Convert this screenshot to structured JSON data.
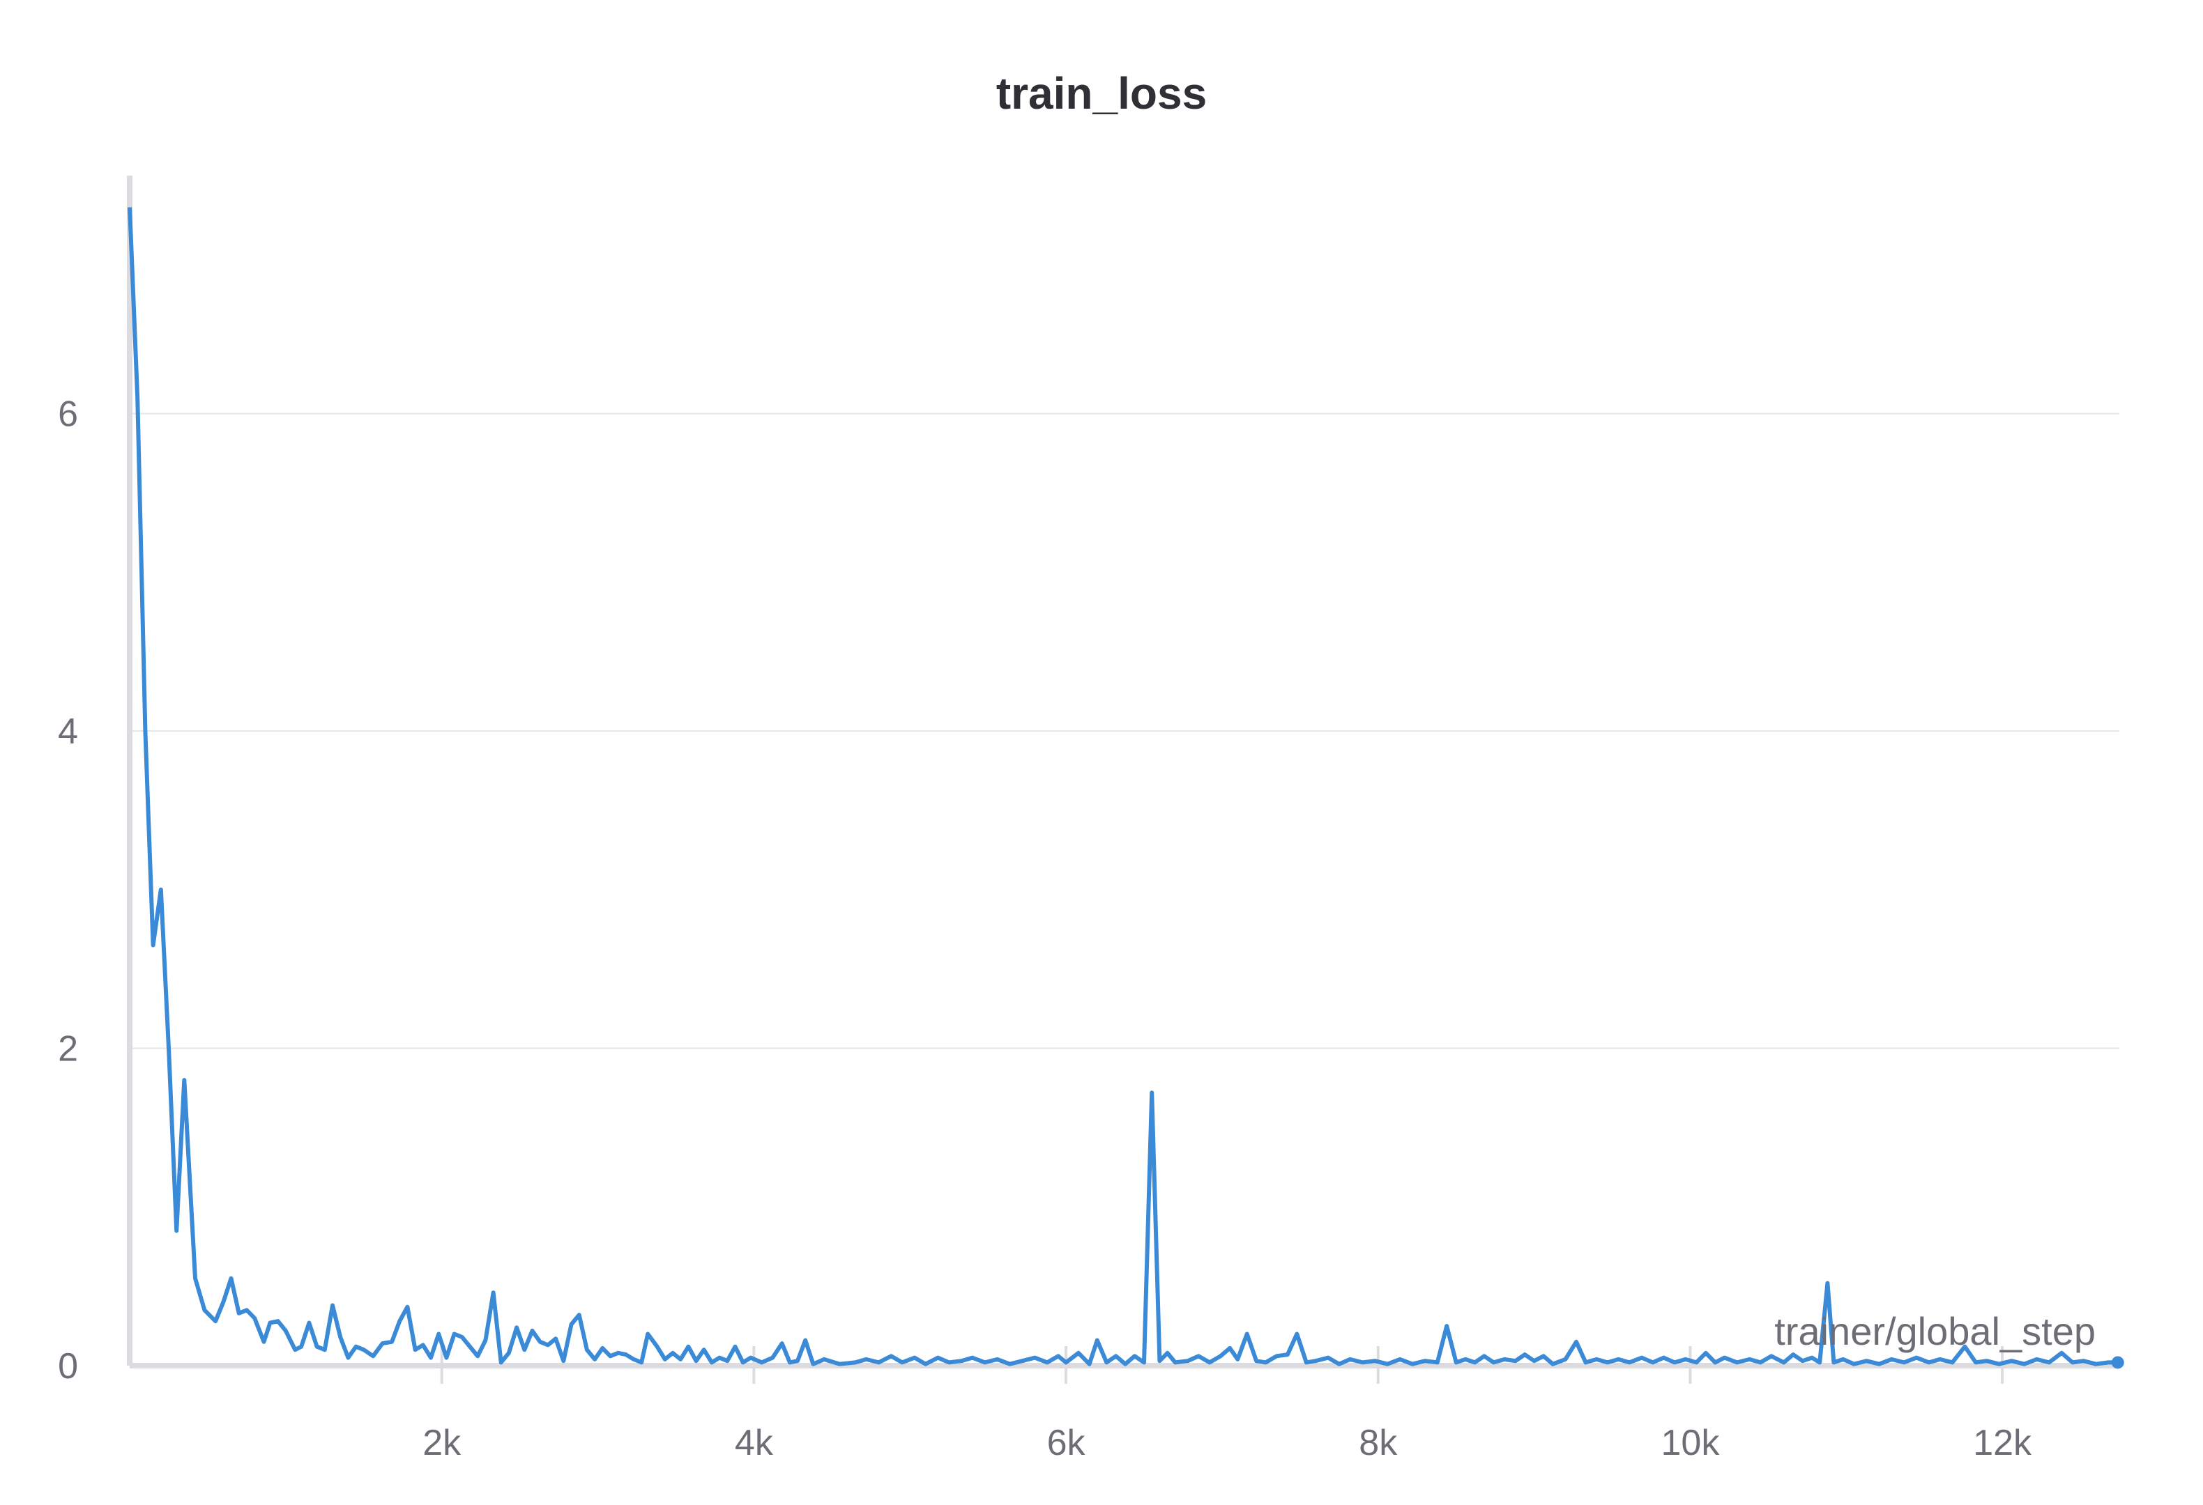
{
  "chart_data": {
    "type": "line",
    "title": "train_loss",
    "xlabel": "trainer/global_step",
    "ylabel": "",
    "xlim": [
      0,
      12750
    ],
    "ylim": [
      0,
      7.5
    ],
    "grid": true,
    "line_color": "#3a8ad8",
    "x_ticks": [
      {
        "value": 2000,
        "label": "2k"
      },
      {
        "value": 4000,
        "label": "4k"
      },
      {
        "value": 6000,
        "label": "6k"
      },
      {
        "value": 8000,
        "label": "8k"
      },
      {
        "value": 10000,
        "label": "10k"
      },
      {
        "value": 12000,
        "label": "12k"
      }
    ],
    "y_ticks": [
      {
        "value": 0,
        "label": "0"
      },
      {
        "value": 2,
        "label": "2"
      },
      {
        "value": 4,
        "label": "4"
      },
      {
        "value": 6,
        "label": "6"
      }
    ],
    "series": [
      {
        "values": [
          [
            0,
            7.3
          ],
          [
            50,
            6.1
          ],
          [
            100,
            4.0
          ],
          [
            150,
            2.65
          ],
          [
            200,
            3.0
          ],
          [
            250,
            2.0
          ],
          [
            300,
            0.85
          ],
          [
            350,
            1.8
          ],
          [
            420,
            0.55
          ],
          [
            480,
            0.35
          ],
          [
            550,
            0.28
          ],
          [
            600,
            0.4
          ],
          [
            650,
            0.55
          ],
          [
            700,
            0.33
          ],
          [
            750,
            0.35
          ],
          [
            800,
            0.3
          ],
          [
            860,
            0.15
          ],
          [
            900,
            0.27
          ],
          [
            950,
            0.28
          ],
          [
            1000,
            0.22
          ],
          [
            1060,
            0.1
          ],
          [
            1100,
            0.12
          ],
          [
            1150,
            0.27
          ],
          [
            1200,
            0.12
          ],
          [
            1250,
            0.1
          ],
          [
            1300,
            0.38
          ],
          [
            1350,
            0.18
          ],
          [
            1400,
            0.05
          ],
          [
            1450,
            0.12
          ],
          [
            1500,
            0.1
          ],
          [
            1560,
            0.06
          ],
          [
            1620,
            0.14
          ],
          [
            1680,
            0.15
          ],
          [
            1730,
            0.28
          ],
          [
            1780,
            0.37
          ],
          [
            1830,
            0.1
          ],
          [
            1880,
            0.13
          ],
          [
            1930,
            0.05
          ],
          [
            1980,
            0.2
          ],
          [
            2030,
            0.05
          ],
          [
            2080,
            0.2
          ],
          [
            2130,
            0.18
          ],
          [
            2180,
            0.12
          ],
          [
            2230,
            0.06
          ],
          [
            2280,
            0.16
          ],
          [
            2330,
            0.46
          ],
          [
            2380,
            0.02
          ],
          [
            2430,
            0.08
          ],
          [
            2480,
            0.24
          ],
          [
            2530,
            0.1
          ],
          [
            2580,
            0.22
          ],
          [
            2630,
            0.15
          ],
          [
            2680,
            0.13
          ],
          [
            2730,
            0.17
          ],
          [
            2780,
            0.03
          ],
          [
            2830,
            0.26
          ],
          [
            2880,
            0.32
          ],
          [
            2930,
            0.1
          ],
          [
            2980,
            0.04
          ],
          [
            3030,
            0.11
          ],
          [
            3080,
            0.06
          ],
          [
            3130,
            0.08
          ],
          [
            3180,
            0.07
          ],
          [
            3230,
            0.04
          ],
          [
            3280,
            0.02
          ],
          [
            3320,
            0.2
          ],
          [
            3380,
            0.12
          ],
          [
            3430,
            0.04
          ],
          [
            3480,
            0.08
          ],
          [
            3530,
            0.04
          ],
          [
            3580,
            0.12
          ],
          [
            3630,
            0.03
          ],
          [
            3680,
            0.1
          ],
          [
            3730,
            0.02
          ],
          [
            3780,
            0.05
          ],
          [
            3830,
            0.03
          ],
          [
            3880,
            0.12
          ],
          [
            3930,
            0.02
          ],
          [
            3980,
            0.05
          ],
          [
            4050,
            0.02
          ],
          [
            4120,
            0.05
          ],
          [
            4180,
            0.14
          ],
          [
            4230,
            0.02
          ],
          [
            4280,
            0.03
          ],
          [
            4330,
            0.16
          ],
          [
            4380,
            0.01
          ],
          [
            4450,
            0.04
          ],
          [
            4550,
            0.01
          ],
          [
            4650,
            0.02
          ],
          [
            4720,
            0.04
          ],
          [
            4800,
            0.02
          ],
          [
            4880,
            0.06
          ],
          [
            4950,
            0.02
          ],
          [
            5030,
            0.05
          ],
          [
            5100,
            0.01
          ],
          [
            5180,
            0.05
          ],
          [
            5250,
            0.02
          ],
          [
            5330,
            0.03
          ],
          [
            5400,
            0.05
          ],
          [
            5480,
            0.02
          ],
          [
            5560,
            0.04
          ],
          [
            5640,
            0.01
          ],
          [
            5720,
            0.03
          ],
          [
            5800,
            0.05
          ],
          [
            5880,
            0.02
          ],
          [
            5950,
            0.06
          ],
          [
            6000,
            0.02
          ],
          [
            6080,
            0.08
          ],
          [
            6150,
            0.01
          ],
          [
            6200,
            0.16
          ],
          [
            6260,
            0.02
          ],
          [
            6320,
            0.06
          ],
          [
            6380,
            0.01
          ],
          [
            6440,
            0.06
          ],
          [
            6500,
            0.02
          ],
          [
            6550,
            1.72
          ],
          [
            6600,
            0.03
          ],
          [
            6650,
            0.08
          ],
          [
            6700,
            0.02
          ],
          [
            6780,
            0.03
          ],
          [
            6850,
            0.06
          ],
          [
            6920,
            0.02
          ],
          [
            6990,
            0.06
          ],
          [
            7050,
            0.11
          ],
          [
            7100,
            0.04
          ],
          [
            7160,
            0.2
          ],
          [
            7220,
            0.03
          ],
          [
            7280,
            0.02
          ],
          [
            7350,
            0.06
          ],
          [
            7420,
            0.07
          ],
          [
            7480,
            0.2
          ],
          [
            7540,
            0.02
          ],
          [
            7600,
            0.03
          ],
          [
            7680,
            0.05
          ],
          [
            7750,
            0.01
          ],
          [
            7820,
            0.04
          ],
          [
            7900,
            0.02
          ],
          [
            7980,
            0.03
          ],
          [
            8060,
            0.01
          ],
          [
            8140,
            0.04
          ],
          [
            8220,
            0.01
          ],
          [
            8300,
            0.03
          ],
          [
            8380,
            0.02
          ],
          [
            8440,
            0.25
          ],
          [
            8500,
            0.02
          ],
          [
            8560,
            0.04
          ],
          [
            8620,
            0.02
          ],
          [
            8680,
            0.06
          ],
          [
            8740,
            0.02
          ],
          [
            8810,
            0.04
          ],
          [
            8880,
            0.03
          ],
          [
            8940,
            0.07
          ],
          [
            9000,
            0.03
          ],
          [
            9060,
            0.06
          ],
          [
            9120,
            0.01
          ],
          [
            9200,
            0.04
          ],
          [
            9270,
            0.15
          ],
          [
            9330,
            0.02
          ],
          [
            9400,
            0.04
          ],
          [
            9470,
            0.02
          ],
          [
            9540,
            0.04
          ],
          [
            9610,
            0.02
          ],
          [
            9690,
            0.05
          ],
          [
            9760,
            0.02
          ],
          [
            9830,
            0.05
          ],
          [
            9900,
            0.02
          ],
          [
            9970,
            0.04
          ],
          [
            10040,
            0.02
          ],
          [
            10100,
            0.08
          ],
          [
            10160,
            0.02
          ],
          [
            10220,
            0.05
          ],
          [
            10300,
            0.02
          ],
          [
            10380,
            0.04
          ],
          [
            10450,
            0.02
          ],
          [
            10520,
            0.06
          ],
          [
            10600,
            0.02
          ],
          [
            10660,
            0.07
          ],
          [
            10720,
            0.03
          ],
          [
            10780,
            0.05
          ],
          [
            10830,
            0.02
          ],
          [
            10880,
            0.52
          ],
          [
            10920,
            0.02
          ],
          [
            10980,
            0.04
          ],
          [
            11050,
            0.01
          ],
          [
            11130,
            0.03
          ],
          [
            11210,
            0.01
          ],
          [
            11290,
            0.04
          ],
          [
            11370,
            0.02
          ],
          [
            11450,
            0.05
          ],
          [
            11530,
            0.02
          ],
          [
            11600,
            0.04
          ],
          [
            11680,
            0.02
          ],
          [
            11760,
            0.12
          ],
          [
            11830,
            0.02
          ],
          [
            11900,
            0.03
          ],
          [
            11980,
            0.01
          ],
          [
            12060,
            0.03
          ],
          [
            12140,
            0.01
          ],
          [
            12220,
            0.04
          ],
          [
            12300,
            0.02
          ],
          [
            12380,
            0.08
          ],
          [
            12450,
            0.02
          ],
          [
            12520,
            0.03
          ],
          [
            12600,
            0.01
          ],
          [
            12680,
            0.02
          ],
          [
            12740,
            0.02
          ]
        ]
      }
    ]
  }
}
